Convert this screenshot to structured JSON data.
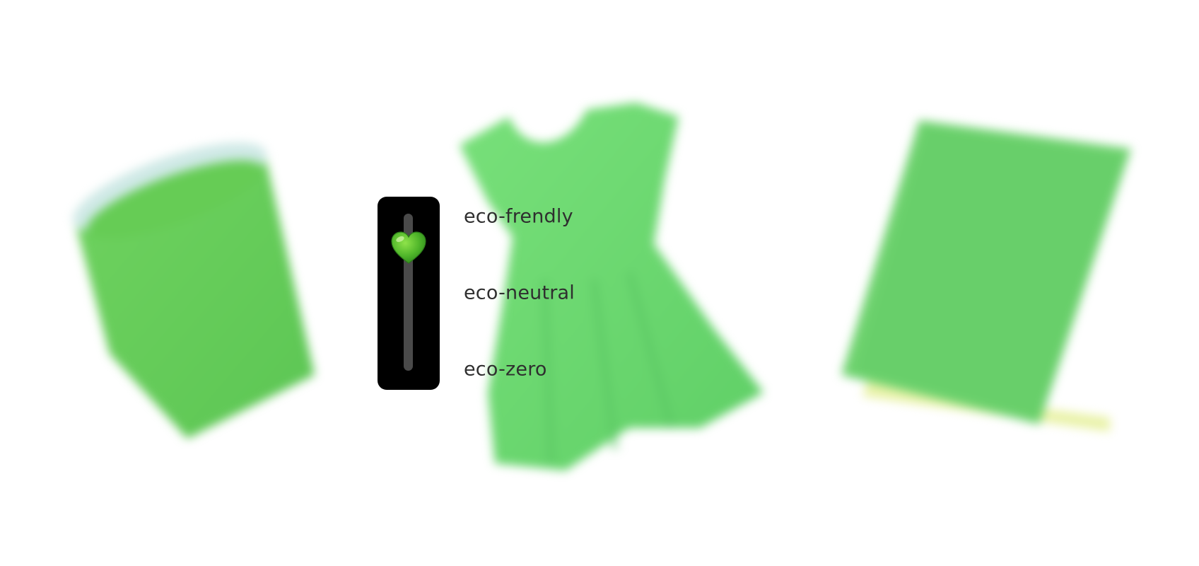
{
  "slider": {
    "levels": [
      {
        "label": "eco-frendly"
      },
      {
        "label": "eco-neutral"
      },
      {
        "label": "eco-zero"
      }
    ],
    "value_fraction_from_top": 0.22,
    "thumb_icon": "green-heart-icon",
    "track_color": "#4a4a4a",
    "panel_color": "#000000"
  },
  "background": {
    "objects": [
      "paper-cup-image",
      "dress-image",
      "notebook-image"
    ],
    "accent_color": "#66cc66"
  }
}
